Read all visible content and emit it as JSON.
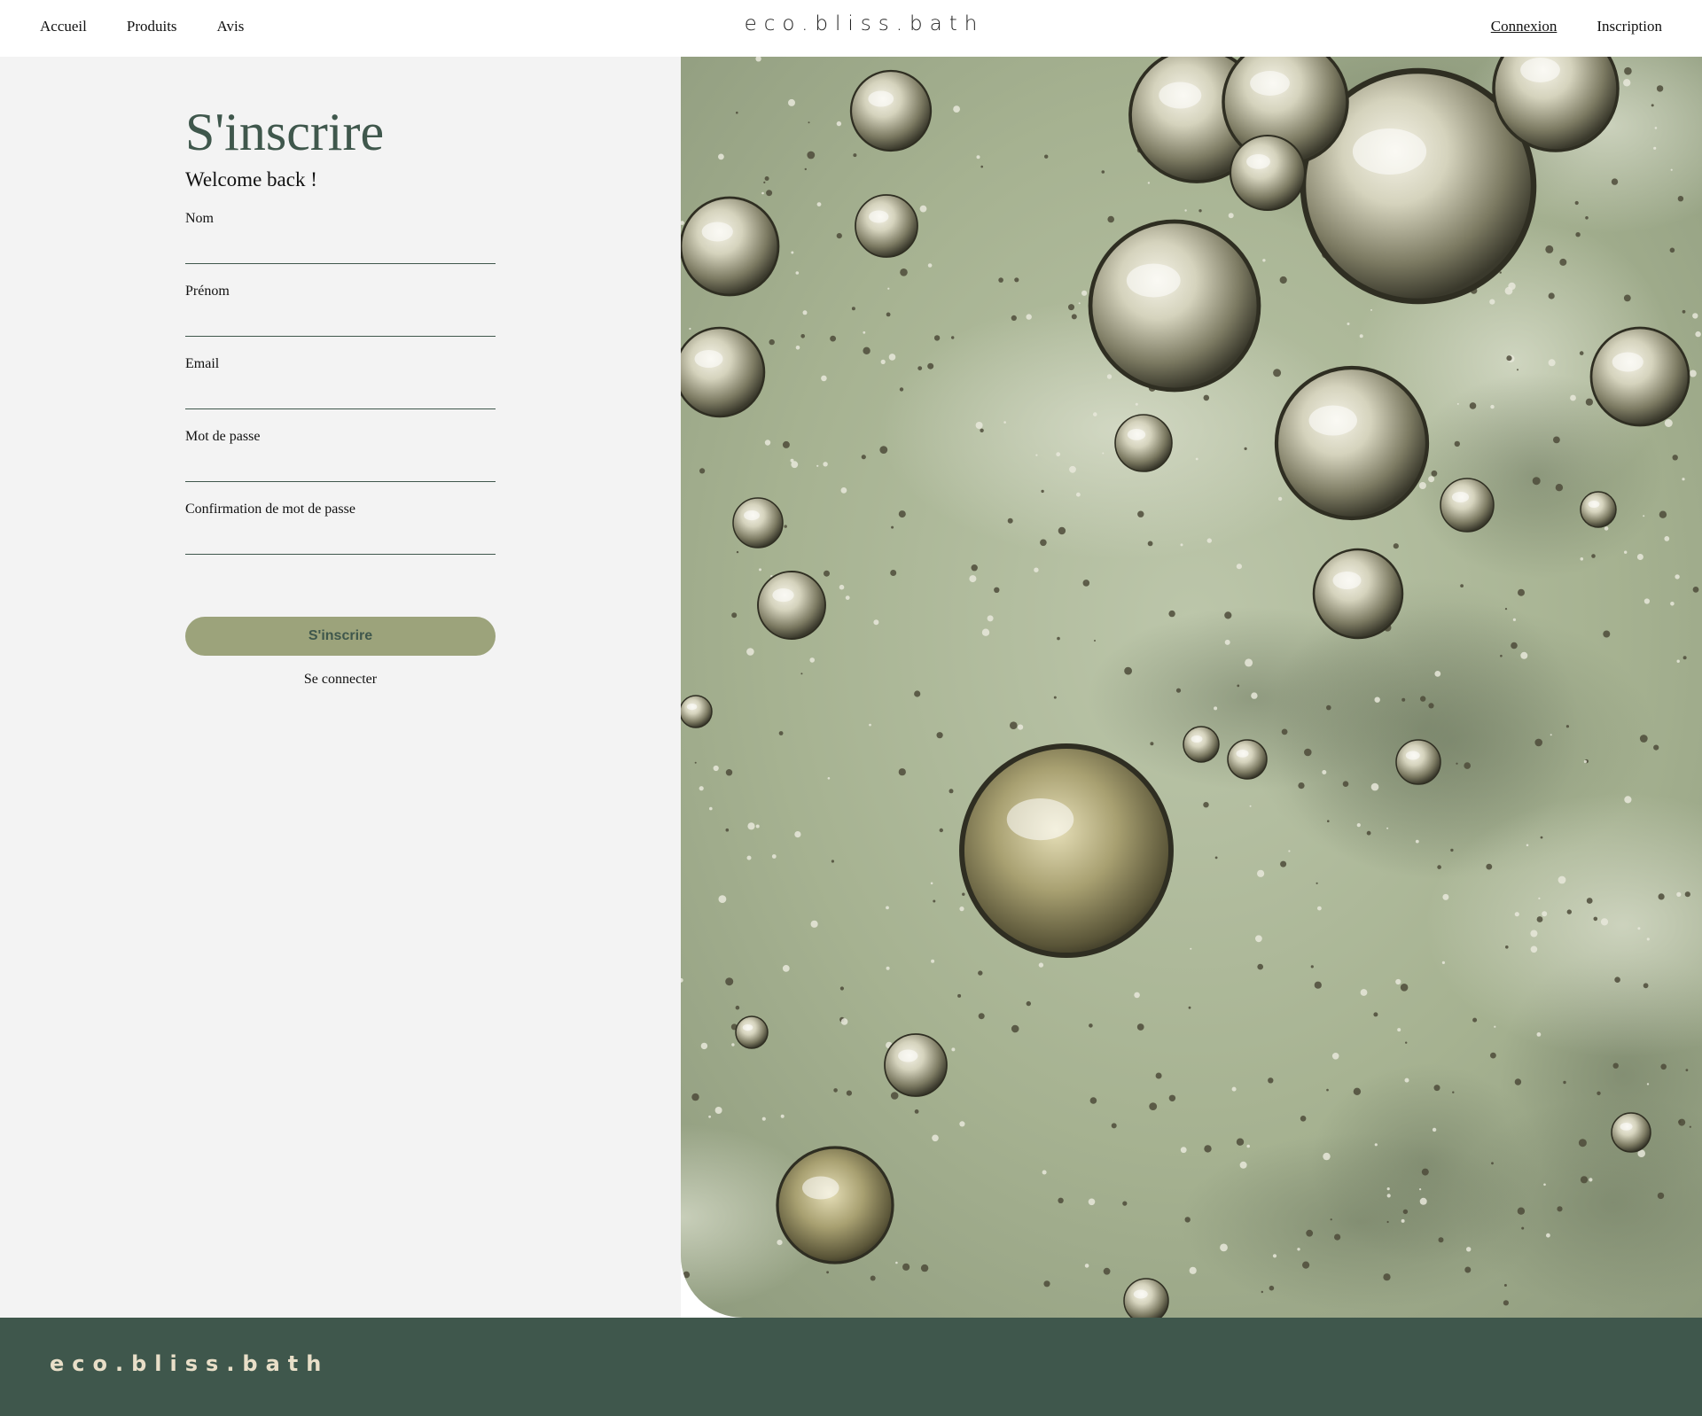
{
  "header": {
    "nav_left": [
      "Accueil",
      "Produits",
      "Avis"
    ],
    "logo": "eco.bliss.bath",
    "nav_right": [
      "Connexion",
      "Inscription"
    ]
  },
  "form": {
    "title": "S'inscrire",
    "subtitle": "Welcome back !",
    "fields": [
      {
        "label": "Nom",
        "value": ""
      },
      {
        "label": "Prénom",
        "value": ""
      },
      {
        "label": "Email",
        "value": ""
      },
      {
        "label": "Mot de passe",
        "value": ""
      },
      {
        "label": "Confirmation de mot de passe",
        "value": ""
      }
    ],
    "submit_label": "S'inscrire",
    "login_link": "Se connecter"
  },
  "footer": {
    "logo": "eco.bliss.bath"
  },
  "colors": {
    "accent": "#3f574c",
    "button": "#9ca37b",
    "panel": "#f3f3f3",
    "footer_text": "#e9dfc8"
  },
  "icons": {
    "hero": "bubbles-image"
  }
}
